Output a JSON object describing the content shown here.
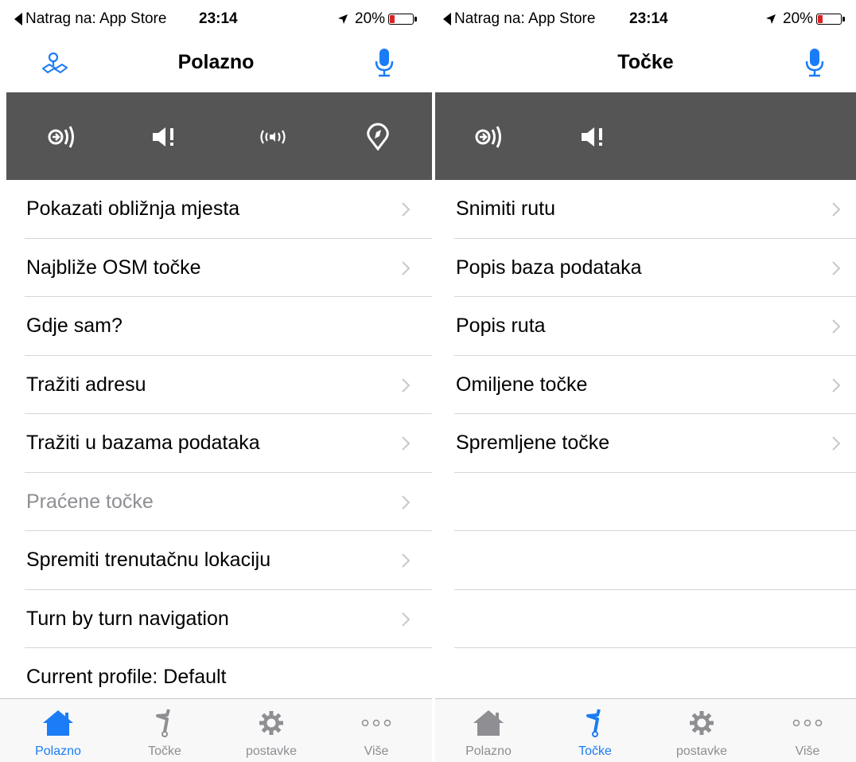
{
  "colors": {
    "accent": "#1a7cf6",
    "toolbar_bg": "#555555",
    "tab_inactive": "#8e8e93",
    "battery_low": "#e02020"
  },
  "left": {
    "status": {
      "back_label": "Natrag na: App Store",
      "time": "23:14",
      "battery": "20%"
    },
    "nav": {
      "title": "Polazno",
      "left_icon": "map-icon",
      "right_icon": "microphone-icon"
    },
    "toolbar": [
      {
        "icon": "scan-signal-icon"
      },
      {
        "icon": "speaker-alert-icon"
      },
      {
        "icon": "broadcast-icon"
      },
      {
        "icon": "compass-pin-icon"
      }
    ],
    "menu": [
      {
        "label": "Pokazati obližnja mjesta",
        "chevron": true,
        "disabled": false
      },
      {
        "label": "Najbliže OSM točke",
        "chevron": true,
        "disabled": false
      },
      {
        "label": "Gdje sam?",
        "chevron": false,
        "disabled": false
      },
      {
        "label": "Tražiti adresu",
        "chevron": true,
        "disabled": false
      },
      {
        "label": "Tražiti u bazama podataka",
        "chevron": true,
        "disabled": false
      },
      {
        "label": "Praćene točke",
        "chevron": true,
        "disabled": true
      },
      {
        "label": "Spremiti trenutačnu lokaciju",
        "chevron": true,
        "disabled": false
      },
      {
        "label": "Turn by turn navigation",
        "chevron": true,
        "disabled": false
      },
      {
        "label": "Current profile: Default",
        "chevron": false,
        "disabled": false
      }
    ],
    "tabs": [
      {
        "label": "Polazno",
        "icon": "home-icon",
        "active": true
      },
      {
        "label": "Točke",
        "icon": "flag-icon",
        "active": false
      },
      {
        "label": "postavke",
        "icon": "gear-icon",
        "active": false
      },
      {
        "label": "Više",
        "icon": "more-icon",
        "active": false
      }
    ]
  },
  "right": {
    "status": {
      "back_label": "Natrag na: App Store",
      "time": "23:14",
      "battery": "20%"
    },
    "nav": {
      "title": "Točke",
      "right_icon": "microphone-icon"
    },
    "toolbar": [
      {
        "icon": "scan-signal-icon"
      },
      {
        "icon": "speaker-alert-icon"
      }
    ],
    "menu": [
      {
        "label": "Snimiti rutu",
        "chevron": true
      },
      {
        "label": "Popis baza podataka",
        "chevron": true
      },
      {
        "label": "Popis ruta",
        "chevron": true
      },
      {
        "label": "Omiljene točke",
        "chevron": true
      },
      {
        "label": "Spremljene točke",
        "chevron": true
      }
    ],
    "tabs": [
      {
        "label": "Polazno",
        "icon": "home-icon",
        "active": false
      },
      {
        "label": "Točke",
        "icon": "flag-icon",
        "active": true
      },
      {
        "label": "postavke",
        "icon": "gear-icon",
        "active": false
      },
      {
        "label": "Više",
        "icon": "more-icon",
        "active": false
      }
    ]
  }
}
